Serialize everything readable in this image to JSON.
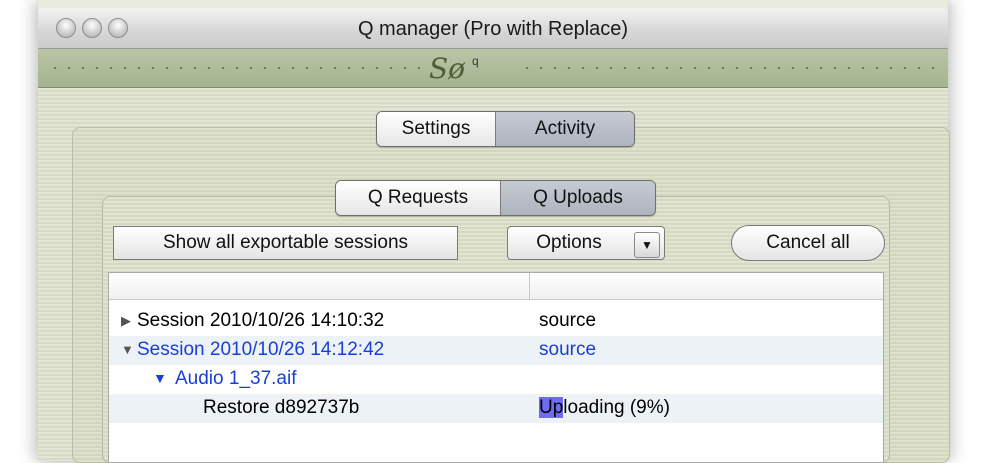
{
  "window": {
    "title": "Q manager (Pro with Replace)"
  },
  "toolbar": {
    "logo": "Sø",
    "logo_sub": "q"
  },
  "tabs": {
    "settings": "Settings",
    "activity": "Activity",
    "selected": "Activity"
  },
  "subtabs": {
    "requests": "Q Requests",
    "uploads": "Q Uploads",
    "selected": "Q Uploads"
  },
  "controls": {
    "show_all": "Show all exportable sessions",
    "options": "Options",
    "cancel_all": "Cancel all"
  },
  "rows": [
    {
      "name": "Session 2010/10/26 14:10:32",
      "status": "source",
      "expanded": false
    },
    {
      "name": "Session 2010/10/26 14:12:42",
      "status": "source",
      "expanded": true
    },
    {
      "name": "Audio 1_37.aif",
      "status": "",
      "expanded": true
    },
    {
      "name": "Restore d892737b",
      "status_highlight": "Up",
      "status_rest": "loading (9%)"
    }
  ],
  "icons": {
    "row_collapsed": "triangle-right-icon",
    "row_expanded": "triangle-down-icon",
    "options_arrow": "chevron-down-icon"
  }
}
